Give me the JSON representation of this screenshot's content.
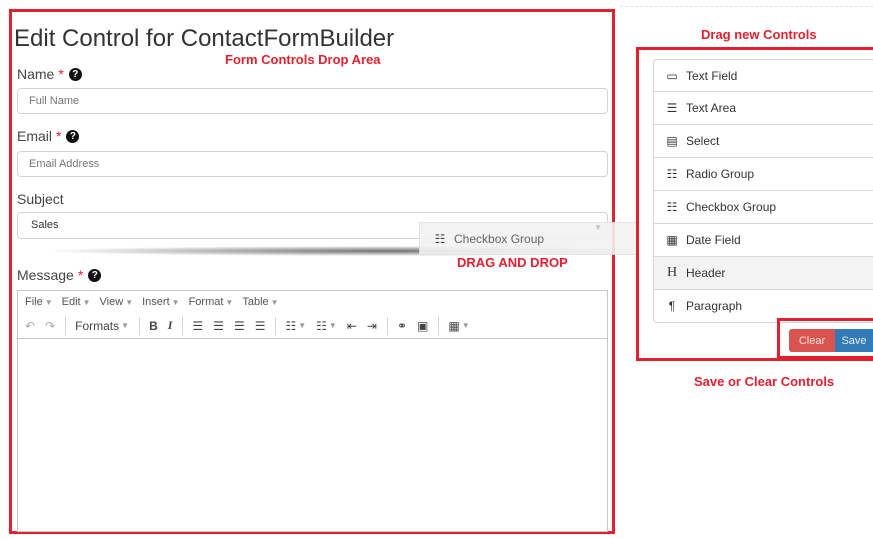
{
  "form": {
    "title": "Edit Control for ContactFormBuilder",
    "fields": {
      "name": {
        "label": "Name",
        "required_mark": "*",
        "placeholder": "Full Name"
      },
      "email": {
        "label": "Email",
        "required_mark": "*",
        "placeholder": "Email Address"
      },
      "subject": {
        "label": "Subject",
        "value": "Sales"
      },
      "message": {
        "label": "Message",
        "required_mark": "*"
      }
    },
    "help_glyph": "?"
  },
  "editor": {
    "menu": [
      "File",
      "Edit",
      "View",
      "Insert",
      "Format",
      "Table"
    ],
    "formats_label": "Formats",
    "bold_label": "B",
    "italic_label": "I"
  },
  "annotations": {
    "drop_area": "Form Controls Drop Area",
    "drag_controls": "Drag new Controls",
    "drag_and_drop": "DRAG AND DROP",
    "save_clear": "Save or Clear Controls"
  },
  "drag_ghost": {
    "label": "Checkbox Group",
    "icon": "checkbox-group-icon"
  },
  "controls": [
    {
      "label": "Text Field",
      "icon": "text-field-icon",
      "glyph": "▭"
    },
    {
      "label": "Text Area",
      "icon": "text-area-icon",
      "glyph": "☰"
    },
    {
      "label": "Select",
      "icon": "select-icon",
      "glyph": "▤"
    },
    {
      "label": "Radio Group",
      "icon": "radio-group-icon",
      "glyph": "☷"
    },
    {
      "label": "Checkbox Group",
      "icon": "checkbox-group-icon",
      "glyph": "☷"
    },
    {
      "label": "Date Field",
      "icon": "calendar-icon",
      "glyph": "▦"
    },
    {
      "label": "Header",
      "icon": "header-icon",
      "glyph": "H"
    },
    {
      "label": "Paragraph",
      "icon": "paragraph-icon",
      "glyph": "¶"
    }
  ],
  "buttons": {
    "clear": "Clear",
    "save": "Save"
  },
  "colors": {
    "annotation_red": "#e3202f",
    "clear": "#d9534f",
    "save": "#337ab7"
  }
}
